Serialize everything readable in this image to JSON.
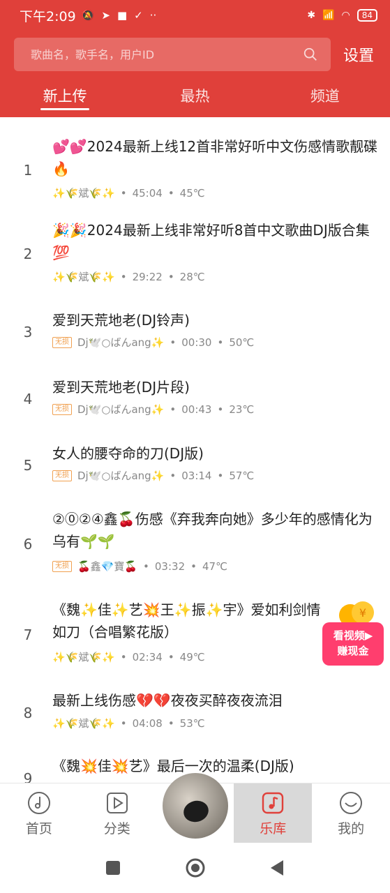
{
  "status": {
    "time": "下午2:09",
    "battery": "84"
  },
  "search": {
    "placeholder": "歌曲名，歌手名，用户ID",
    "settings_label": "设置"
  },
  "tabs": [
    {
      "label": "新上传",
      "active": true
    },
    {
      "label": "最热",
      "active": false
    },
    {
      "label": "频道",
      "active": false
    }
  ],
  "songs": [
    {
      "index": "1",
      "title": "💕💕2024最新上线12首非常好听中文伤感情歌靓碟🔥",
      "tag": "",
      "author": "✨🌾斌🌾✨",
      "duration": "45:04",
      "temp": "45℃"
    },
    {
      "index": "2",
      "title": "🎉🎉2024最新上线非常好听8首中文歌曲DJ版合集💯",
      "tag": "",
      "author": "✨🌾斌🌾✨",
      "duration": "29:22",
      "temp": "28℃"
    },
    {
      "index": "3",
      "title": "爱到天荒地老(DJ铃声)",
      "tag": "无损",
      "author": "Dj🕊️○ばんang✨",
      "duration": "00:30",
      "temp": "50℃"
    },
    {
      "index": "4",
      "title": "爱到天荒地老(DJ片段)",
      "tag": "无损",
      "author": "Dj🕊️○ばんang✨",
      "duration": "00:43",
      "temp": "23℃"
    },
    {
      "index": "5",
      "title": "女人的腰夺命的刀(DJ版)",
      "tag": "无损",
      "author": "Dj🕊️○ばんang✨",
      "duration": "03:14",
      "temp": "57℃"
    },
    {
      "index": "6",
      "title": "②⓪②④鑫🍒伤感《弃我奔向她》多少年的感情化为乌有🌱🌱",
      "tag": "无损",
      "author": "🍒鑫💎寶🍒",
      "duration": "03:32",
      "temp": "47℃"
    },
    {
      "index": "7",
      "title": "《魏✨佳✨艺💥王✨振✨宇》爱如利剑情如刀（合唱繁花版）",
      "tag": "",
      "author": "✨🌾斌🌾✨",
      "duration": "02:34",
      "temp": "49℃"
    },
    {
      "index": "8",
      "title": "最新上线伤感💔💔夜夜买醉夜夜流泪",
      "tag": "",
      "author": "✨🌾斌🌾✨",
      "duration": "04:08",
      "temp": "53℃"
    },
    {
      "index": "9",
      "title": "《魏💥佳💥艺》最后一次的温柔(DJ版)",
      "tag": "",
      "author": "",
      "duration": "",
      "temp": ""
    }
  ],
  "promo": {
    "line1": "看视频▶",
    "line2": "赚现金"
  },
  "nav": {
    "home": "首页",
    "category": "分类",
    "library": "乐库",
    "mine": "我的"
  },
  "colors": {
    "brand": "#e0403a",
    "promo": "#ff3e6e",
    "tag": "#f0a050"
  }
}
